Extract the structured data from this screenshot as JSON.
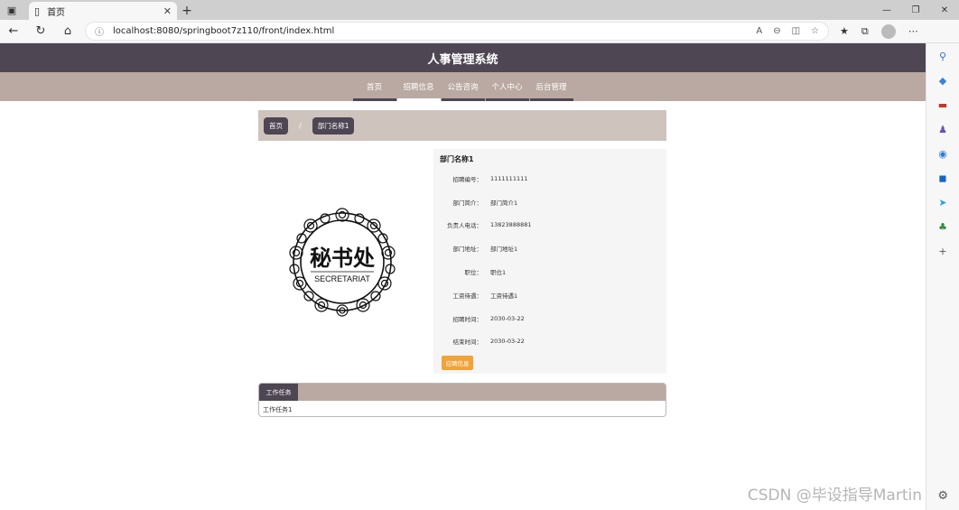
{
  "browser": {
    "tab_title": "首页",
    "url": "localhost:8080/springboot7z110/front/index.html",
    "icons": {
      "sidebar_toggle": "sidebar-icon",
      "page": "page-icon",
      "close": "close-icon",
      "new_tab": "plus-icon",
      "back": "arrow-left-icon",
      "refresh": "refresh-icon",
      "home": "home-icon",
      "info": "info-icon",
      "more": "ellipsis-icon"
    }
  },
  "site": {
    "title": "人事管理系统",
    "nav": [
      {
        "label": "首页",
        "active": false
      },
      {
        "label": "招聘信息",
        "active": true
      },
      {
        "label": "公告咨询",
        "active": false
      },
      {
        "label": "个人中心",
        "active": false
      },
      {
        "label": "后台管理",
        "active": false
      }
    ]
  },
  "breadcrumb": {
    "home": "首页",
    "separator": "/",
    "current": "部门名称1"
  },
  "logo": {
    "main": "秘书处",
    "sub": "SECRETARIAT"
  },
  "detail": {
    "title": "部门名称1",
    "fields": [
      {
        "label": "招聘编号：",
        "value": "1111111111"
      },
      {
        "label": "部门简介：",
        "value": "部门简介1"
      },
      {
        "label": "负责人电话：",
        "value": "13823888881"
      },
      {
        "label": "部门地址：",
        "value": "部门地址1"
      },
      {
        "label": "职位：",
        "value": "职位1"
      },
      {
        "label": "工资待遇：",
        "value": "工资待遇1"
      },
      {
        "label": "招聘时间：",
        "value": "2030-03-22"
      },
      {
        "label": "结束时间：",
        "value": "2030-03-22"
      }
    ],
    "apply_label": "应聘信息",
    "apply_color": "#f0a33a"
  },
  "task": {
    "tab_label": "工作任务",
    "content": "工作任务1"
  },
  "watermark": "CSDN @毕设指导Martin",
  "colors": {
    "header_bg": "#4e4653",
    "nav_bg": "#b9a9a2",
    "breadcrumb_bg": "#cfc4bd"
  }
}
